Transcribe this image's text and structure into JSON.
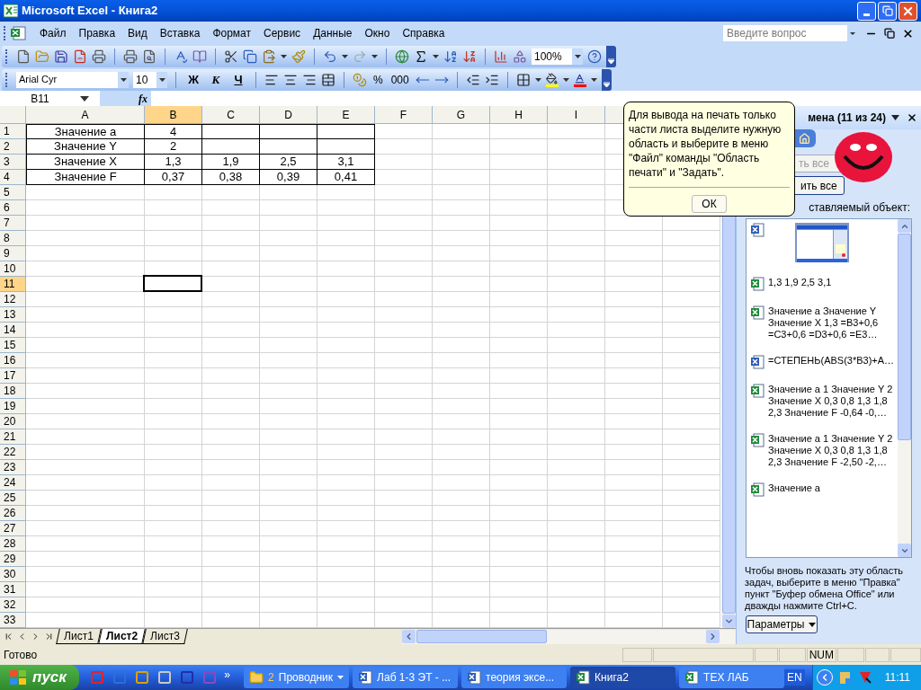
{
  "window": {
    "title": "Microsoft Excel - Книга2"
  },
  "menu": {
    "items": [
      "Файл",
      "Правка",
      "Вид",
      "Вставка",
      "Формат",
      "Сервис",
      "Данные",
      "Окно",
      "Справка"
    ],
    "help_placeholder": "Введите вопрос"
  },
  "standard_toolbar": {
    "zoom": "100%"
  },
  "formatting_toolbar": {
    "font": "Arial Cyr",
    "size": "10",
    "style_buttons": [
      "Ж",
      "К",
      "Ч"
    ],
    "percent": "%",
    "thousands": "000"
  },
  "formula_bar": {
    "name_box": "B11",
    "function_label": "fx"
  },
  "sheet": {
    "columns": [
      {
        "label": "A",
        "selected": false
      },
      {
        "label": "B",
        "selected": true
      },
      {
        "label": "C",
        "selected": false
      },
      {
        "label": "D",
        "selected": false
      },
      {
        "label": "E",
        "selected": false
      },
      {
        "label": "F",
        "selected": false
      },
      {
        "label": "G",
        "selected": false
      },
      {
        "label": "H",
        "selected": false
      },
      {
        "label": "I",
        "selected": false
      }
    ],
    "row_headers": [
      {
        "label": "1",
        "selected": false
      },
      {
        "label": "2",
        "selected": false
      },
      {
        "label": "3",
        "selected": false
      },
      {
        "label": "4",
        "selected": false
      },
      {
        "label": "5",
        "selected": false
      },
      {
        "label": "6",
        "selected": false
      },
      {
        "label": "7",
        "selected": false
      },
      {
        "label": "8",
        "selected": false
      },
      {
        "label": "9",
        "selected": false
      },
      {
        "label": "10",
        "selected": false
      },
      {
        "label": "11",
        "selected": true
      },
      {
        "label": "12",
        "selected": false
      },
      {
        "label": "13",
        "selected": false
      },
      {
        "label": "14",
        "selected": false
      },
      {
        "label": "15",
        "selected": false
      },
      {
        "label": "16",
        "selected": false
      },
      {
        "label": "17",
        "selected": false
      },
      {
        "label": "18",
        "selected": false
      },
      {
        "label": "19",
        "selected": false
      },
      {
        "label": "20",
        "selected": false
      },
      {
        "label": "21",
        "selected": false
      },
      {
        "label": "22",
        "selected": false
      },
      {
        "label": "23",
        "selected": false
      },
      {
        "label": "24",
        "selected": false
      },
      {
        "label": "25",
        "selected": false
      },
      {
        "label": "26",
        "selected": false
      },
      {
        "label": "27",
        "selected": false
      },
      {
        "label": "28",
        "selected": false
      },
      {
        "label": "29",
        "selected": false
      },
      {
        "label": "30",
        "selected": false
      },
      {
        "label": "31",
        "selected": false
      },
      {
        "label": "32",
        "selected": false
      },
      {
        "label": "33",
        "selected": false
      }
    ],
    "data_rows": [
      [
        "Значение а",
        "4"
      ],
      [
        "Значение Y",
        "2"
      ],
      [
        "Значение X",
        "1,3",
        "1,9",
        "2,5",
        "3,1"
      ],
      [
        "Значение F",
        "0,37",
        "0,38",
        "0,39",
        "0,41"
      ]
    ]
  },
  "sheet_tabs": [
    {
      "label": "Лист1",
      "selected": false
    },
    {
      "label": "Лист2",
      "selected": true
    },
    {
      "label": "Лист3",
      "selected": false
    }
  ],
  "status_bar": {
    "text": "Готово",
    "indicators": [
      "NUM"
    ]
  },
  "task_pane": {
    "title": "мена (11 из 24)",
    "paste_all": "ть все",
    "clear_all": "ить все",
    "list_label": "ставляемый объект:",
    "items": [
      {
        "kind": "picture"
      },
      {
        "kind": "excel",
        "lines": [
          "1,3 1,9 2,5 3,1"
        ]
      },
      {
        "kind": "excel",
        "lines": [
          "Значение а Значение Y",
          "Значение X 1,3 =B3+0,6",
          "=C3+0,6 =D3+0,6 =E3…"
        ]
      },
      {
        "kind": "word",
        "lines": [
          "=СТЕПЕНЬ(ABS(3*B3)+A…"
        ]
      },
      {
        "kind": "excel",
        "lines": [
          "Значение а 1 Значение Y 2",
          "Значение X 0,3 0,8 1,3 1,8",
          "2,3 Значение F -0,64 -0,…"
        ]
      },
      {
        "kind": "excel",
        "lines": [
          "Значение а 1 Значение Y 2",
          "Значение X 0,3 0,8 1,3 1,8",
          "2,3 Значение F -2,50 -2,…"
        ]
      },
      {
        "kind": "excel",
        "lines": [
          "Значение а"
        ]
      }
    ],
    "hint": "Чтобы вновь показать эту область задач, выберите в меню \"Правка\" пункт \"Буфер обмена Office\" или дважды нажмите Ctrl+C.",
    "options": "Параметры"
  },
  "balloon": {
    "text": "Для вывода на печать только части листа выделите нужную область и выберите в меню \"Файл\" команды \"Область печати\" и \"Задать\".",
    "button": "ОК"
  },
  "taskbar": {
    "start": "пуск",
    "more": "»",
    "buttons": [
      {
        "kind": "folder",
        "count": "2",
        "label": "Проводник",
        "selected": false
      },
      {
        "kind": "word",
        "label": "Лаб 1-3 ЭТ - ...",
        "selected": false
      },
      {
        "kind": "word",
        "label": "теория эксе...",
        "selected": false
      },
      {
        "kind": "excel",
        "label": "Книга2",
        "selected": true
      },
      {
        "kind": "excel",
        "label": "ТЕХ ЛАБ",
        "selected": false
      }
    ],
    "language": "EN",
    "clock": "11:11"
  }
}
